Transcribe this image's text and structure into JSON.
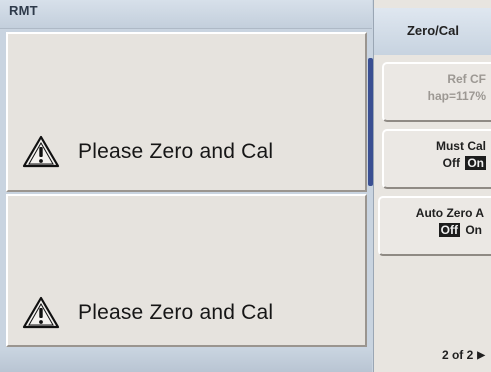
{
  "status_bar": {
    "text": "RMT"
  },
  "panes": [
    {
      "message": "Please Zero and Cal",
      "icon": "warning-triangle-icon"
    },
    {
      "message": "Please Zero and Cal",
      "icon": "warning-triangle-icon"
    }
  ],
  "softkeys": {
    "menu_title": "Zero/Cal",
    "ref_cf": {
      "line1": "Ref CF",
      "line2": "hap=117%"
    },
    "must_cal": {
      "label": "Must Cal",
      "off": "Off",
      "on": "On",
      "selected": "On"
    },
    "auto_zero": {
      "label": "Auto Zero A",
      "off": "Off",
      "on": "On",
      "selected": "Off"
    },
    "page": "2 of 2",
    "page_arrow_icon": "triangle-right-icon"
  },
  "colors": {
    "background": "#c9d4e0",
    "pane": "#e6e3de",
    "scroll_indicator": "#3a4f92",
    "selected_option": "#1d1d1d"
  }
}
